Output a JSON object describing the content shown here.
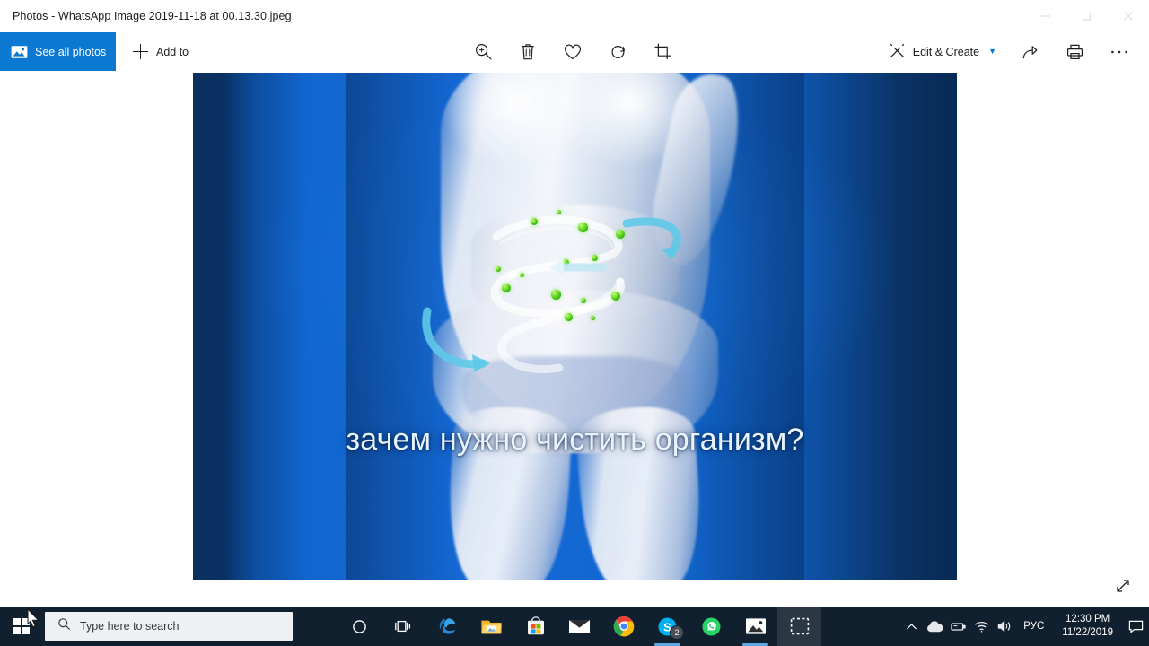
{
  "window": {
    "title": "Photos - WhatsApp Image 2019-11-18 at 00.13.30.jpeg",
    "controls": [
      {
        "name": "minimize",
        "glyph": "minimize-icon"
      },
      {
        "name": "restore",
        "glyph": "restore-icon"
      },
      {
        "name": "close",
        "glyph": "close-icon"
      }
    ]
  },
  "toolbar": {
    "see_all_photos": "See all photos",
    "add_to": "Add to",
    "edit_create": "Edit & Create",
    "center_tools": [
      {
        "name": "zoom",
        "icon": "zoom-in-icon"
      },
      {
        "name": "delete",
        "icon": "trash-icon"
      },
      {
        "name": "favorite",
        "icon": "heart-icon"
      },
      {
        "name": "rotate",
        "icon": "rotate-icon"
      },
      {
        "name": "crop",
        "icon": "crop-icon"
      }
    ],
    "right_tools": [
      {
        "name": "share",
        "icon": "share-icon"
      },
      {
        "name": "print",
        "icon": "print-icon"
      },
      {
        "name": "see-more",
        "icon": "ellipsis-icon"
      }
    ]
  },
  "photo": {
    "caption": "зачем нужно чистить организм?",
    "colors": {
      "background_blue": "#1569d6",
      "edge_navy": "#0a3162",
      "particle_green": "#5fd321",
      "arrow_cyan": "#5fc9e8",
      "caption_text": "#e8f4fd"
    },
    "expand_label": "expand-icon"
  },
  "taskbar": {
    "search_placeholder": "Type here to search",
    "apps": [
      {
        "name": "cortana",
        "label": "Cortana",
        "active": false,
        "running": false,
        "badge": null
      },
      {
        "name": "taskview",
        "label": "Task View",
        "active": false,
        "running": false,
        "badge": null
      },
      {
        "name": "edge",
        "label": "Microsoft Edge",
        "active": false,
        "running": true,
        "badge": null
      },
      {
        "name": "explorer",
        "label": "File Explorer",
        "active": false,
        "running": true,
        "badge": null
      },
      {
        "name": "store",
        "label": "Microsoft Store",
        "active": false,
        "running": false,
        "badge": null
      },
      {
        "name": "mail",
        "label": "Mail",
        "active": false,
        "running": false,
        "badge": null
      },
      {
        "name": "chrome",
        "label": "Google Chrome",
        "active": false,
        "running": true,
        "badge": null
      },
      {
        "name": "skype",
        "label": "Skype",
        "active": false,
        "running": true,
        "badge": "2"
      },
      {
        "name": "whatsapp",
        "label": "WhatsApp",
        "active": false,
        "running": true,
        "badge": null
      },
      {
        "name": "photos",
        "label": "Photos",
        "active": false,
        "running": true,
        "badge": null
      },
      {
        "name": "snip",
        "label": "Snip & Sketch",
        "active": true,
        "running": false,
        "badge": null
      }
    ],
    "tray": {
      "language": "РУС",
      "time": "12:30 PM",
      "date": "11/22/2019",
      "icons": [
        {
          "name": "show-hidden-icons",
          "glyph": "chevron-up-icon"
        },
        {
          "name": "onedrive",
          "glyph": "cloud-icon"
        },
        {
          "name": "removable-device",
          "glyph": "device-icon"
        },
        {
          "name": "network",
          "glyph": "wifi-icon"
        },
        {
          "name": "volume",
          "glyph": "speaker-icon"
        }
      ],
      "action_center": "notification-icon"
    }
  }
}
